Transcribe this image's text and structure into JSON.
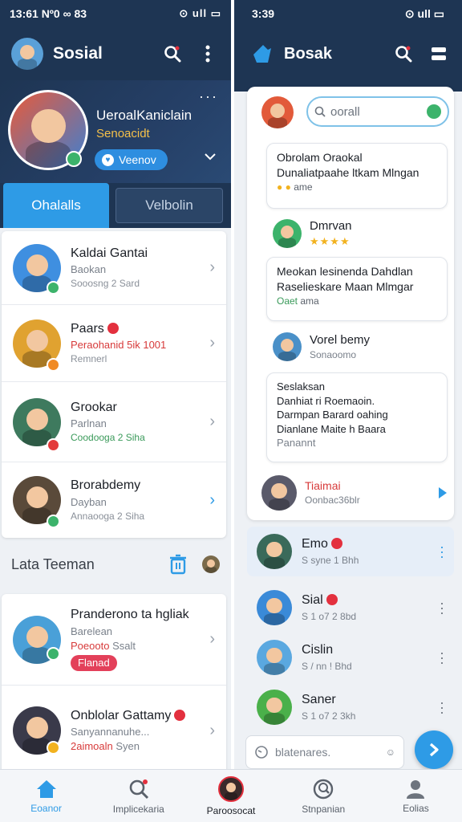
{
  "colors": {
    "header": "#1e3553",
    "accent": "#2e9be6",
    "online": "#3cb36b",
    "alert": "#e3405a"
  },
  "left": {
    "status": {
      "time": "13:61 Nº0 ∞ 83",
      "right": "⊙ ull ▭"
    },
    "header": {
      "title": "Sosial"
    },
    "profile": {
      "name": "UeroalKaniclain",
      "subtitle": "Senoacidt",
      "pill": "Veenov"
    },
    "tabs": {
      "active": "Ohalalls",
      "inactive": "Velbolin"
    },
    "friends": [
      {
        "name": "Kaldai Gantai",
        "sub": "Baokan",
        "meta": "Sooosng 2 Sard",
        "badge": "#3cb36b"
      },
      {
        "name": "Paars",
        "sub": "Peraohanid 5ik 1001",
        "meta": "Remnerl",
        "badge": "#f08a24"
      },
      {
        "name": "Grookar",
        "sub": "Parlnan",
        "meta": "Coodooga 2 Siha",
        "badge": "#e33b3b"
      },
      {
        "name": "Brorabdemy",
        "sub": "Dayban",
        "meta": "Annaooga 2 Siha",
        "badge": "#3cb36b"
      }
    ],
    "section_title": "Lata Teeman",
    "list": [
      {
        "name": "Pranderono ta hgliak",
        "sub": "Barelean",
        "meta": "Poeooto",
        "meta2": "Ssalt",
        "pill": "Flanad"
      },
      {
        "name": "Onblolar Gattamy",
        "sub": "Sanyannanuhe...",
        "meta": "2aimoaln",
        "meta2": "Syen"
      }
    ]
  },
  "right": {
    "status": {
      "time": "3:39",
      "right": "⊙ ull ▭"
    },
    "header": {
      "title": "Bosak"
    },
    "search": {
      "placeholder": "oorall"
    },
    "posts": [
      {
        "line1": "Obrolam Oraokal",
        "line2": "Dunaliatpaahe ltkam Mlngan",
        "line3": "ame"
      },
      {
        "name": "Dmrvan"
      },
      {
        "line1": "Meokan lesinenda Dahdlan",
        "line2": "Raselieskare Maan Mlmgar",
        "line3": "Oaet",
        "line4": "ama"
      },
      {
        "name": "Vorel bemy",
        "sub": "Sonaoomo"
      },
      {
        "line1": "Seslaksan",
        "line2": "Danhiat ri Roemaoin.",
        "line3": "Darmpan Barard oahing",
        "line4": "Dianlane Maite h Baara",
        "line5": "Panannt"
      },
      {
        "name": "Tiaimai",
        "sub": "Oonbac36blr"
      }
    ],
    "chats": [
      {
        "name": "Emo",
        "sub": "S syne 1 Bhh"
      },
      {
        "name": "Sial",
        "sub": "S 1 o7 2 8bd"
      },
      {
        "name": "Cislin",
        "sub": "S / nn ! Bhd"
      },
      {
        "name": "Saner",
        "sub": "S 1 o7 2 3kh"
      }
    ],
    "compose": {
      "placeholder": "blatenares."
    }
  },
  "nav": [
    {
      "label": "Eoanor",
      "icon": "home-icon"
    },
    {
      "label": "Implicekaria",
      "icon": "search-icon"
    },
    {
      "label": "Paroosocat",
      "icon": "profile-avatar-icon"
    },
    {
      "label": "Stnpanian",
      "icon": "explore-icon"
    },
    {
      "label": "Eolias",
      "icon": "user-icon"
    }
  ]
}
